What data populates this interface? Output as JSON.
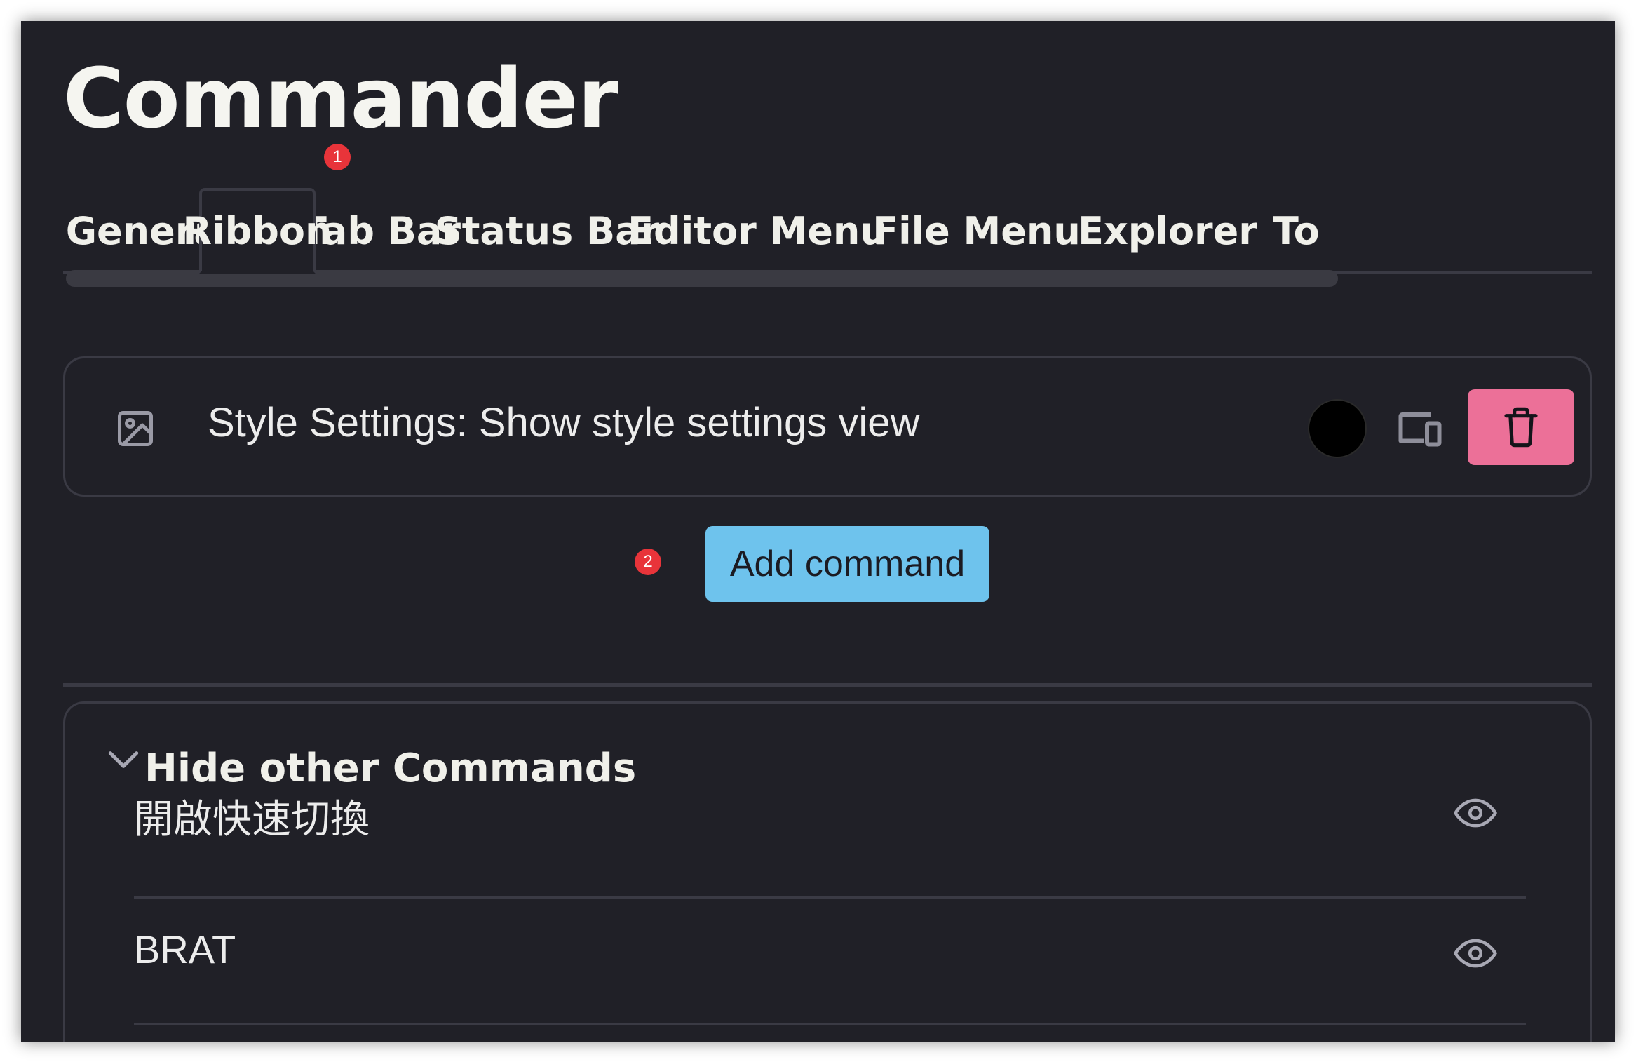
{
  "page": {
    "title": "Commander"
  },
  "tabs": [
    {
      "label": "General",
      "active": false
    },
    {
      "label": "Ribbon",
      "active": true
    },
    {
      "label": "Tab Bar",
      "active": false
    },
    {
      "label": "Status Bar",
      "active": false
    },
    {
      "label": "Editor Menu",
      "active": false
    },
    {
      "label": "File Menu",
      "active": false
    },
    {
      "label": "Explorer",
      "active": false
    },
    {
      "label": "To",
      "active": false
    }
  ],
  "annotations": {
    "badge_1": "1",
    "badge_2": "2"
  },
  "command_card": {
    "icon": "image-icon",
    "label": "Style Settings: Show style settings view",
    "color_swatch": "#000000",
    "device_icon": "device-mode-icon",
    "delete_icon": "trash-icon"
  },
  "add_command": {
    "label": "Add command"
  },
  "hidden_commands": {
    "title": "Hide other Commands",
    "collapse_icon": "chevron-down-icon",
    "items": [
      {
        "label": "開啟快速切換",
        "icon": "eye-icon"
      },
      {
        "label": "BRAT",
        "icon": "eye-icon"
      }
    ]
  },
  "colors": {
    "background": "#202027",
    "text": "#f0f0ea",
    "border": "#3a3a44",
    "delete_accent": "#ec7098",
    "primary_button": "#6ec3ed",
    "badge": "#e8343a"
  }
}
